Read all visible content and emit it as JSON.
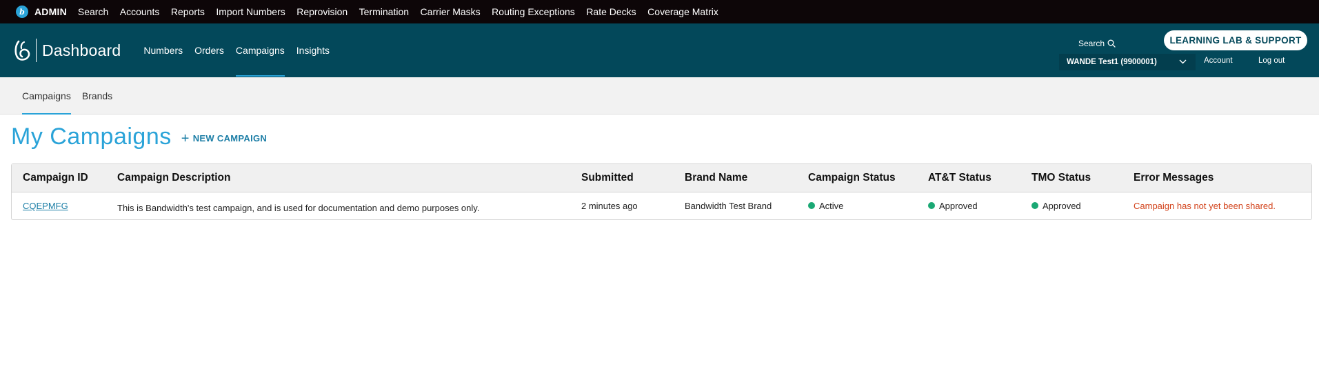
{
  "admin_bar": {
    "label": "ADMIN",
    "links": [
      "Search",
      "Accounts",
      "Reports",
      "Import Numbers",
      "Reprovision",
      "Termination",
      "Carrier Masks",
      "Routing Exceptions",
      "Rate Decks",
      "Coverage Matrix"
    ]
  },
  "header": {
    "title": "Dashboard",
    "nav": [
      "Numbers",
      "Orders",
      "Campaigns",
      "Insights"
    ],
    "active_nav": "Campaigns",
    "search_label": "Search",
    "learning_button": "LEARNING LAB & SUPPORT",
    "account_selector": "WANDE Test1 (9900001)",
    "account_link": "Account",
    "logout_link": "Log out"
  },
  "sub_nav": {
    "items": [
      "Campaigns",
      "Brands"
    ],
    "active": "Campaigns"
  },
  "page": {
    "title": "My Campaigns",
    "new_campaign": "NEW CAMPAIGN"
  },
  "table": {
    "columns": [
      "Campaign ID",
      "Campaign Description",
      "Submitted",
      "Brand Name",
      "Campaign Status",
      "AT&T Status",
      "TMO Status",
      "Error Messages"
    ],
    "rows": [
      {
        "campaign_id": "CQEPMFG",
        "description": "This is Bandwidth's test campaign, and is used for documentation and demo purposes only.",
        "submitted": "2 minutes ago",
        "brand_name": "Bandwidth Test Brand",
        "campaign_status": "Active",
        "att_status": "Approved",
        "tmo_status": "Approved",
        "error_message": "Campaign has not yet been shared."
      }
    ]
  },
  "colors": {
    "admin_bar_bg": "#0d0608",
    "header_bg": "#03485a",
    "accent": "#2aa3d8",
    "status_green": "#1aa874",
    "error_red": "#d2421a"
  }
}
